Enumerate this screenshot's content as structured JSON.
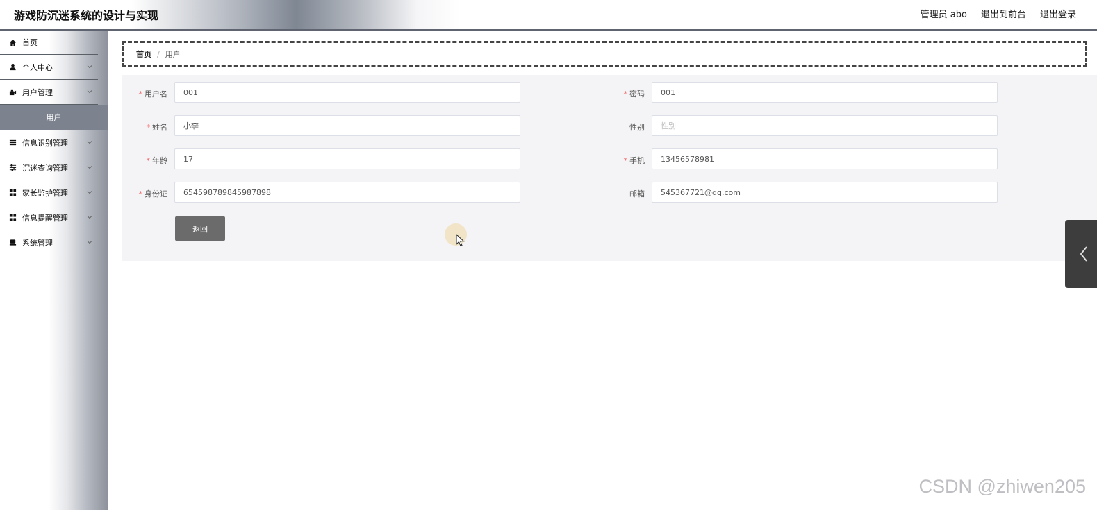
{
  "header": {
    "title": "游戏防沉迷系统的设计与实现",
    "admin_label": "管理员 abo",
    "front_label": "退出到前台",
    "logout_label": "退出登录"
  },
  "sidebar": {
    "items": [
      {
        "label": "首页",
        "icon": "home-icon"
      },
      {
        "label": "个人中心",
        "icon": "user-icon"
      },
      {
        "label": "用户管理",
        "icon": "user-manage-icon"
      },
      {
        "label": "信息识别管理",
        "icon": "list-icon"
      },
      {
        "label": "沉迷查询管理",
        "icon": "sliders-icon"
      },
      {
        "label": "家长监护管理",
        "icon": "grid-icon"
      },
      {
        "label": "信息提醒管理",
        "icon": "grid-icon"
      },
      {
        "label": "系统管理",
        "icon": "monitor-icon"
      }
    ],
    "active_sub": "用户"
  },
  "breadcrumb": {
    "home": "首页",
    "separator": "/",
    "current": "用户"
  },
  "form": {
    "username": {
      "label": "用户名",
      "value": "001",
      "required": true
    },
    "password": {
      "label": "密码",
      "value": "001",
      "required": true
    },
    "name": {
      "label": "姓名",
      "value": "小李",
      "required": true
    },
    "gender": {
      "label": "性别",
      "value": "",
      "placeholder": "性别",
      "required": false
    },
    "age": {
      "label": "年龄",
      "value": "17",
      "required": true
    },
    "phone": {
      "label": "手机",
      "value": "13456578981",
      "required": true
    },
    "idcard": {
      "label": "身份证",
      "value": "654598789845987898",
      "required": true
    },
    "email": {
      "label": "邮箱",
      "value": "545367721@qq.com",
      "required": false
    },
    "back_label": "返回"
  },
  "watermark": "CSDN @zhiwen205",
  "colors": {
    "required": "#f56c6c",
    "button": "#6b6b6b",
    "sub_active": "#7d838e",
    "side_tab": "#3d3d3d"
  }
}
